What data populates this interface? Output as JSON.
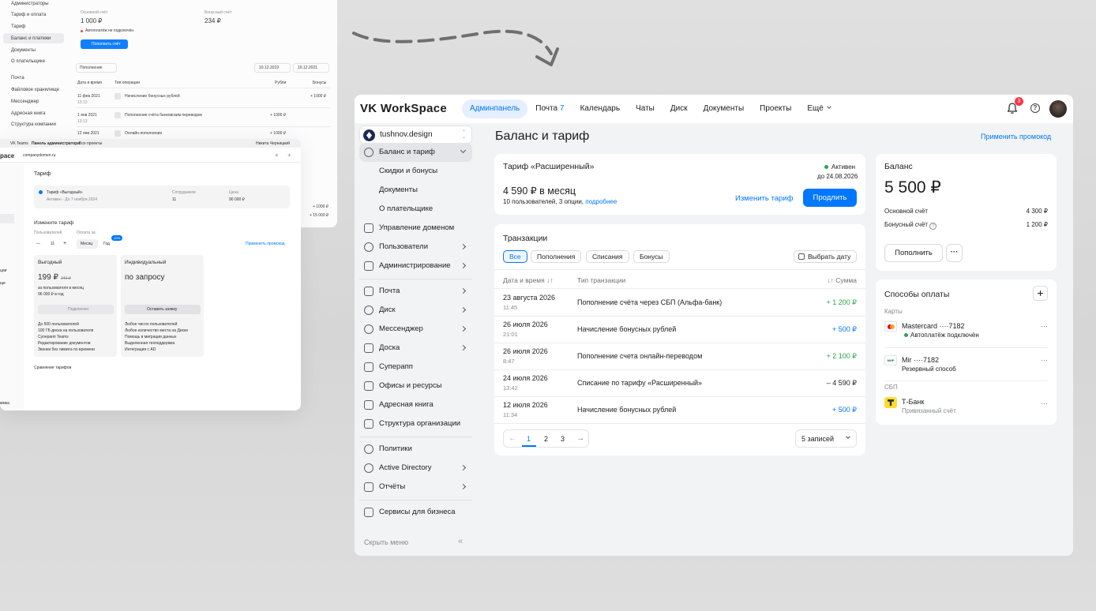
{
  "back1": {
    "sidebar": [
      "Администраторы",
      "Тариф и оплата",
      "Тариф",
      "Баланс и платежи",
      "Документы",
      "О плательщике",
      "Почта",
      "Файловое хранилище",
      "Мессенджер",
      "Адресная книга",
      "Структура компании"
    ],
    "main_account_label": "Основной счёт",
    "main_account_value": "1 000 ₽",
    "bonus_account_label": "Бонусный счёт",
    "bonus_account_value": "234 ₽",
    "autopay": "Автоплатёж не подключён",
    "topup_button": "Пополнить счёт",
    "filter": "Пополнение",
    "date_from": "10.12.2019",
    "date_to": "10.12.2021",
    "columns": [
      "Дата и время",
      "Тип операции",
      "Рубли",
      "Бонусы"
    ],
    "rows": [
      {
        "date": "11 фев 2021",
        "time": "13:13",
        "type": "Начисление бонусных рублей",
        "rub": "",
        "bonus": "+ 1000 ₽"
      },
      {
        "date": "1 янв 2021",
        "time": "13:13",
        "type": "Пополнение счёта банковским переводом",
        "rub": "+ 1000 ₽",
        "bonus": ""
      },
      {
        "date": "12 янв 2021",
        "time": "",
        "type": "Онлайн-пополнение",
        "rub": "+ 1000 ₽",
        "bonus": ""
      }
    ],
    "extra_values": [
      "+ 1000 ₽",
      "+ 15 000 ₽"
    ]
  },
  "back2": {
    "tabs": [
      "VK Teams",
      "Панель администратора",
      "Все проекты"
    ],
    "user": "Никита Черницкий",
    "logo": "pace",
    "domain": "companydomen.ru",
    "sidebar_letters": [
      "ции",
      "ще"
    ],
    "sidebar_bottom": "ммка",
    "title": "Тариф",
    "current_plan": "Тариф «Выгодный»",
    "current_status": "Активен · До 7 ноября 2024",
    "employees_label": "Сотрудников",
    "employees_value": "11",
    "price_label": "Цена",
    "price_value": "90 000 ₽",
    "change_title": "Измените тариф",
    "users_label": "Пользователей",
    "pay_label": "Оплата за",
    "count": "11",
    "period_month": "Месяц",
    "period_year": "Год",
    "discount": "-20%",
    "promo": "Применить промокод",
    "plan1_name": "Выгодный",
    "plan1_price": "199 ₽",
    "plan1_old": "240 ₽",
    "plan1_note": "за пользователя в месяц",
    "plan1_year": "96 000 ₽ в год",
    "plan1_button": "Подключен",
    "plan1_features": [
      "До 500 пользователей",
      "100 ГБ диска на пользователя",
      "Суперапп Teams",
      "Редактирование документов",
      "Звонки без лимита по времени"
    ],
    "plan2_name": "Индивидуальный",
    "plan2_price": "по запросу",
    "plan2_button": "Оставить заявку",
    "plan2_features": [
      "Любое число пользователей",
      "Любое количество места на Диске",
      "Помощь в миграции данных",
      "Выделенная техподдержка",
      "Интеграция с AD"
    ],
    "compare": "Сравнение тарифов"
  },
  "app": {
    "logo": "VK WorkSpace",
    "nav": [
      {
        "label": "Админпанель",
        "count": ""
      },
      {
        "label": "Почта",
        "count": "7"
      },
      {
        "label": "Календарь",
        "count": ""
      },
      {
        "label": "Чаты",
        "count": ""
      },
      {
        "label": "Диск",
        "count": ""
      },
      {
        "label": "Документы",
        "count": ""
      },
      {
        "label": "Проекты",
        "count": ""
      },
      {
        "label": "Ещё",
        "count": ""
      }
    ],
    "notifications": "3",
    "help": "?",
    "org_name": "tushnov.design",
    "sidebar": {
      "items": [
        "Баланс и тариф",
        "Скидки и бонусы",
        "Документы",
        "О плательщике",
        "Управление доменом",
        "Пользователи",
        "Администрирование",
        "Почта",
        "Диск",
        "Мессенджер",
        "Доска",
        "Суперапп",
        "Офисы и ресурсы",
        "Адресная книга",
        "Структура организации",
        "Политики",
        "Active Directory",
        "Отчёты",
        "Сервисы для бизнеса"
      ],
      "hide": "Скрыть меню",
      "hide_icon": "«"
    },
    "page_title": "Баланс и тариф",
    "promo_link": "Применить промокод",
    "tariff": {
      "name": "Тариф «Расширенный»",
      "status": "Активен",
      "until": "до 24.08.2026",
      "price": "4 590 ₽ в месяц",
      "details": "10 пользователей, 3 опции,",
      "more": "подробнее",
      "change": "Изменить тариф",
      "extend": "Продлить"
    },
    "transactions": {
      "title": "Транзакции",
      "filters": [
        "Все",
        "Пополнения",
        "Списания",
        "Бонусы"
      ],
      "date_button": "Выбрать дату",
      "col_date": "Дата и время",
      "col_type": "Тип транзакции",
      "col_sum": "Сумма",
      "rows": [
        {
          "date": "23 августа 2026",
          "time": "11:45",
          "type": "Пополнение счёта через СБП (Альфа-банк)",
          "amount": "+ 1 200 ₽"
        },
        {
          "date": "26 июля 2026",
          "time": "21:01",
          "type": "Начисление бонусных рублей",
          "amount": "+ 500 ₽"
        },
        {
          "date": "26 июля 2026",
          "time": "8:47",
          "type": "Пополнение счета онлайн-переводом",
          "amount": "+ 2 100 ₽"
        },
        {
          "date": "24 июля 2026",
          "time": "13:42",
          "type": "Списание по тарифу «Расширенный»",
          "amount": "– 4 590 ₽"
        },
        {
          "date": "12 июля 2026",
          "time": "11:34",
          "type": "Начисление бонусных рублей",
          "amount": "+ 500 ₽"
        }
      ],
      "pages": [
        "1",
        "2",
        "3"
      ],
      "per_page": "5 записей"
    },
    "balance": {
      "title": "Баланс",
      "amount": "5 500 ₽",
      "main_label": "Основной счёт",
      "main_value": "4 300 ₽",
      "bonus_label": "Бонусный счёт",
      "bonus_value": "1 200 ₽",
      "topup": "Пополнить",
      "more": "···"
    },
    "payments": {
      "title": "Способы оплаты",
      "cards_label": "Карты",
      "card1_name": "Mastercard ····7182",
      "card1_sub": "Автоплатёж подключён",
      "card2_brand": "МИР",
      "card2_name": "Mir ····7182",
      "card2_sub": "Резервный способ",
      "sbp_label": "СБП",
      "bank_name": "Т-Банк",
      "bank_sub": "Привязанный счёт",
      "more": "···"
    }
  }
}
